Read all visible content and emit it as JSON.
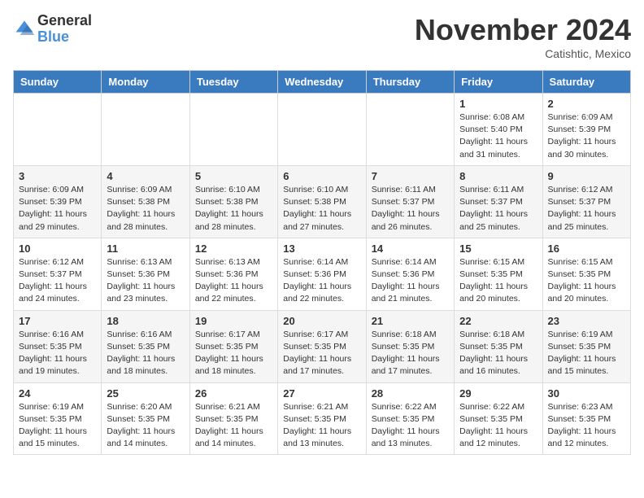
{
  "logo": {
    "general": "General",
    "blue": "Blue"
  },
  "header": {
    "month": "November 2024",
    "location": "Catishtic, Mexico"
  },
  "weekdays": [
    "Sunday",
    "Monday",
    "Tuesday",
    "Wednesday",
    "Thursday",
    "Friday",
    "Saturday"
  ],
  "weeks": [
    [
      {
        "day": "",
        "info": ""
      },
      {
        "day": "",
        "info": ""
      },
      {
        "day": "",
        "info": ""
      },
      {
        "day": "",
        "info": ""
      },
      {
        "day": "",
        "info": ""
      },
      {
        "day": "1",
        "info": "Sunrise: 6:08 AM\nSunset: 5:40 PM\nDaylight: 11 hours and 31 minutes."
      },
      {
        "day": "2",
        "info": "Sunrise: 6:09 AM\nSunset: 5:39 PM\nDaylight: 11 hours and 30 minutes."
      }
    ],
    [
      {
        "day": "3",
        "info": "Sunrise: 6:09 AM\nSunset: 5:39 PM\nDaylight: 11 hours and 29 minutes."
      },
      {
        "day": "4",
        "info": "Sunrise: 6:09 AM\nSunset: 5:38 PM\nDaylight: 11 hours and 28 minutes."
      },
      {
        "day": "5",
        "info": "Sunrise: 6:10 AM\nSunset: 5:38 PM\nDaylight: 11 hours and 28 minutes."
      },
      {
        "day": "6",
        "info": "Sunrise: 6:10 AM\nSunset: 5:38 PM\nDaylight: 11 hours and 27 minutes."
      },
      {
        "day": "7",
        "info": "Sunrise: 6:11 AM\nSunset: 5:37 PM\nDaylight: 11 hours and 26 minutes."
      },
      {
        "day": "8",
        "info": "Sunrise: 6:11 AM\nSunset: 5:37 PM\nDaylight: 11 hours and 25 minutes."
      },
      {
        "day": "9",
        "info": "Sunrise: 6:12 AM\nSunset: 5:37 PM\nDaylight: 11 hours and 25 minutes."
      }
    ],
    [
      {
        "day": "10",
        "info": "Sunrise: 6:12 AM\nSunset: 5:37 PM\nDaylight: 11 hours and 24 minutes."
      },
      {
        "day": "11",
        "info": "Sunrise: 6:13 AM\nSunset: 5:36 PM\nDaylight: 11 hours and 23 minutes."
      },
      {
        "day": "12",
        "info": "Sunrise: 6:13 AM\nSunset: 5:36 PM\nDaylight: 11 hours and 22 minutes."
      },
      {
        "day": "13",
        "info": "Sunrise: 6:14 AM\nSunset: 5:36 PM\nDaylight: 11 hours and 22 minutes."
      },
      {
        "day": "14",
        "info": "Sunrise: 6:14 AM\nSunset: 5:36 PM\nDaylight: 11 hours and 21 minutes."
      },
      {
        "day": "15",
        "info": "Sunrise: 6:15 AM\nSunset: 5:35 PM\nDaylight: 11 hours and 20 minutes."
      },
      {
        "day": "16",
        "info": "Sunrise: 6:15 AM\nSunset: 5:35 PM\nDaylight: 11 hours and 20 minutes."
      }
    ],
    [
      {
        "day": "17",
        "info": "Sunrise: 6:16 AM\nSunset: 5:35 PM\nDaylight: 11 hours and 19 minutes."
      },
      {
        "day": "18",
        "info": "Sunrise: 6:16 AM\nSunset: 5:35 PM\nDaylight: 11 hours and 18 minutes."
      },
      {
        "day": "19",
        "info": "Sunrise: 6:17 AM\nSunset: 5:35 PM\nDaylight: 11 hours and 18 minutes."
      },
      {
        "day": "20",
        "info": "Sunrise: 6:17 AM\nSunset: 5:35 PM\nDaylight: 11 hours and 17 minutes."
      },
      {
        "day": "21",
        "info": "Sunrise: 6:18 AM\nSunset: 5:35 PM\nDaylight: 11 hours and 17 minutes."
      },
      {
        "day": "22",
        "info": "Sunrise: 6:18 AM\nSunset: 5:35 PM\nDaylight: 11 hours and 16 minutes."
      },
      {
        "day": "23",
        "info": "Sunrise: 6:19 AM\nSunset: 5:35 PM\nDaylight: 11 hours and 15 minutes."
      }
    ],
    [
      {
        "day": "24",
        "info": "Sunrise: 6:19 AM\nSunset: 5:35 PM\nDaylight: 11 hours and 15 minutes."
      },
      {
        "day": "25",
        "info": "Sunrise: 6:20 AM\nSunset: 5:35 PM\nDaylight: 11 hours and 14 minutes."
      },
      {
        "day": "26",
        "info": "Sunrise: 6:21 AM\nSunset: 5:35 PM\nDaylight: 11 hours and 14 minutes."
      },
      {
        "day": "27",
        "info": "Sunrise: 6:21 AM\nSunset: 5:35 PM\nDaylight: 11 hours and 13 minutes."
      },
      {
        "day": "28",
        "info": "Sunrise: 6:22 AM\nSunset: 5:35 PM\nDaylight: 11 hours and 13 minutes."
      },
      {
        "day": "29",
        "info": "Sunrise: 6:22 AM\nSunset: 5:35 PM\nDaylight: 11 hours and 12 minutes."
      },
      {
        "day": "30",
        "info": "Sunrise: 6:23 AM\nSunset: 5:35 PM\nDaylight: 11 hours and 12 minutes."
      }
    ]
  ]
}
